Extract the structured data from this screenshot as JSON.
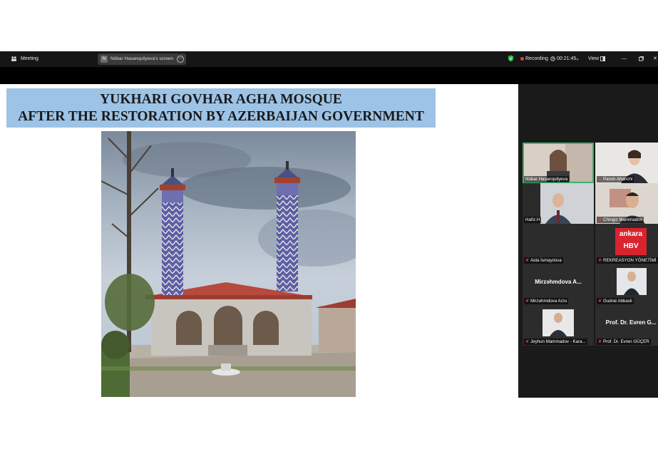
{
  "app": {
    "meeting_label": "Meeting",
    "screen_share_label": "Nübar Hasanquliyeva's screen",
    "screen_share_avatar": "N",
    "recording_label": "Recording",
    "timer": "00:21:45",
    "view_label": "View"
  },
  "slide": {
    "title_line1": "YUKHARI GOVHAR AGHA MOSQUE",
    "title_line2": "AFTER THE RESTORATION BY AZERBAIJAN GOVERNMENT"
  },
  "participants": [
    {
      "name": "Nübar Hasanquliyeva",
      "muted": false,
      "active": true,
      "video": true
    },
    {
      "name": "Parvin Ahanchi",
      "muted": true,
      "active": false,
      "video": true
    },
    {
      "name": "Hafiz.H",
      "muted": false,
      "active": false,
      "video": true
    },
    {
      "name": "Chingiz Mammadov",
      "muted": true,
      "active": false,
      "video": true
    },
    {
      "name": "Aida İsmayılova",
      "muted": true,
      "active": false,
      "video": false
    },
    {
      "name": "REKREASYON YÖNETİMİ",
      "muted": true,
      "active": false,
      "video": false,
      "logo_text": "ankara HBV"
    },
    {
      "name": "Mirzəhmdova Arzu",
      "display": "Mirzəhmdova A...",
      "muted": true,
      "active": false,
      "video": false
    },
    {
      "name": "Gudrat Abbasli",
      "muted": true,
      "active": false,
      "video": true
    },
    {
      "name": "Jeyhun Mammadov - Kara...",
      "muted": true,
      "active": false,
      "video": true
    },
    {
      "name": "Prof. Dr. Evren GÜÇER",
      "display": "Prof. Dr. Evren G...",
      "muted": true,
      "active": false,
      "video": false
    }
  ],
  "colors": {
    "title_bg": "#9dc3e6",
    "topbar_bg": "#161616",
    "panel_bg": "#1a1a1a",
    "active_speaker": "#3cb371",
    "record_red": "#e0463d",
    "shield_green": "#2eb84b"
  },
  "icons": [
    "meeting-icon",
    "shield-icon",
    "record-dot-icon",
    "clock-icon",
    "chevron-down-icon",
    "view-icon",
    "minimize-icon",
    "maximize-icon",
    "close-icon",
    "mic-muted-icon",
    "more-icon"
  ]
}
